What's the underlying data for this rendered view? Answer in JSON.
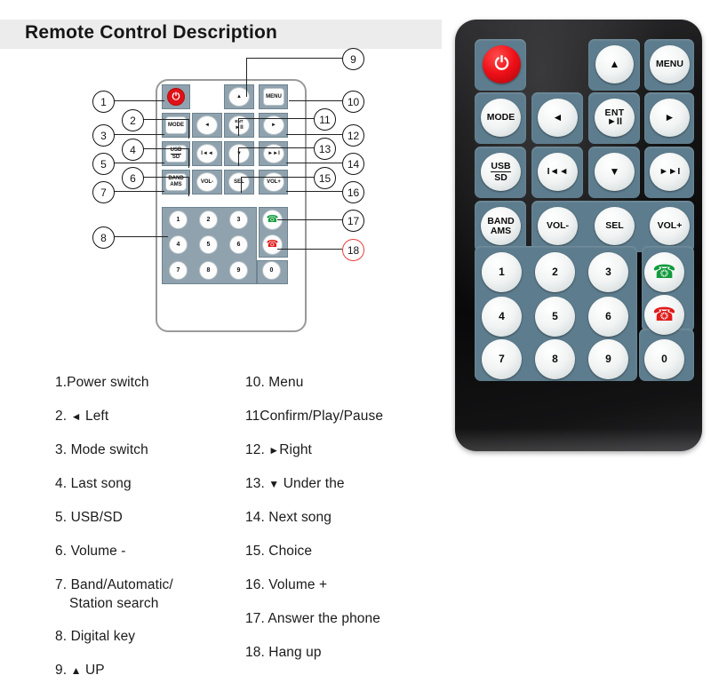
{
  "header": {
    "title": "Remote Control Description"
  },
  "diagram": {
    "name": "remote-control-line-drawing",
    "buttons": [
      {
        "key": "power",
        "label": "",
        "type": "power"
      },
      {
        "key": "up",
        "label": "▲",
        "type": "round"
      },
      {
        "key": "menu",
        "label": "MENU",
        "type": "square"
      },
      {
        "key": "mode",
        "label": "MODE",
        "type": "square"
      },
      {
        "key": "left",
        "label": "◄",
        "type": "round"
      },
      {
        "key": "ent",
        "label": "ENT",
        "label2": "►II",
        "type": "round"
      },
      {
        "key": "right",
        "label": "►",
        "type": "round"
      },
      {
        "key": "usbsd",
        "label": "USB",
        "label2": "SD",
        "type": "square"
      },
      {
        "key": "prev",
        "label": "I◄◄",
        "type": "round"
      },
      {
        "key": "down",
        "label": "▼",
        "type": "round"
      },
      {
        "key": "next",
        "label": "►►I",
        "type": "round"
      },
      {
        "key": "bandams",
        "label": "BAND",
        "label2": "AMS",
        "type": "square"
      },
      {
        "key": "volminus",
        "label": "VOL-",
        "type": "round"
      },
      {
        "key": "sel",
        "label": "SEL",
        "type": "round"
      },
      {
        "key": "volplus",
        "label": "VOL+",
        "type": "round"
      }
    ],
    "keypad": [
      "1",
      "2",
      "3",
      "4",
      "5",
      "6",
      "7",
      "8",
      "9",
      "0"
    ],
    "call_buttons": [
      {
        "key": "answer",
        "glyph": "✆",
        "color": "#0f9d3a"
      },
      {
        "key": "hangup",
        "glyph": "✆",
        "color": "#e11b1b"
      }
    ],
    "callouts": [
      {
        "n": "1"
      },
      {
        "n": "2"
      },
      {
        "n": "3"
      },
      {
        "n": "4"
      },
      {
        "n": "5"
      },
      {
        "n": "6"
      },
      {
        "n": "7"
      },
      {
        "n": "8"
      },
      {
        "n": "9"
      },
      {
        "n": "10"
      },
      {
        "n": "11"
      },
      {
        "n": "12"
      },
      {
        "n": "13"
      },
      {
        "n": "14"
      },
      {
        "n": "15"
      },
      {
        "n": "16"
      },
      {
        "n": "17"
      },
      {
        "n": "18"
      }
    ]
  },
  "photo": {
    "name": "remote-control-photo",
    "buttons": [
      {
        "key": "power",
        "label": "",
        "label2": ""
      },
      {
        "key": "up",
        "label": "▲",
        "label2": ""
      },
      {
        "key": "menu",
        "label": "MENU",
        "label2": ""
      },
      {
        "key": "mode",
        "label": "MODE",
        "label2": ""
      },
      {
        "key": "left",
        "label": "◄",
        "label2": ""
      },
      {
        "key": "ent",
        "label": "ENT",
        "label2": "►II"
      },
      {
        "key": "right",
        "label": "►",
        "label2": ""
      },
      {
        "key": "usbsd",
        "label": "USB",
        "label2": "SD"
      },
      {
        "key": "prev",
        "label": "I◄◄",
        "label2": ""
      },
      {
        "key": "down",
        "label": "▼",
        "label2": ""
      },
      {
        "key": "next",
        "label": "►►I",
        "label2": ""
      },
      {
        "key": "bandams",
        "label": "BAND",
        "label2": "AMS"
      },
      {
        "key": "volminus",
        "label": "VOL-",
        "label2": ""
      },
      {
        "key": "sel",
        "label": "SEL",
        "label2": ""
      },
      {
        "key": "volplus",
        "label": "VOL+",
        "label2": ""
      }
    ],
    "keypad": [
      "1",
      "2",
      "3",
      "4",
      "5",
      "6",
      "7",
      "8",
      "9",
      "0"
    ],
    "call_buttons": [
      {
        "key": "answer",
        "glyph": "✆"
      },
      {
        "key": "hangup",
        "glyph": "✆"
      }
    ]
  },
  "legend": {
    "left": [
      {
        "num": "1.",
        "glyph": "",
        "text": "Power switch",
        "sub": ""
      },
      {
        "num": "2.",
        "glyph": "◄",
        "text": "Left",
        "sub": ""
      },
      {
        "num": "3.",
        "glyph": "",
        "text": "Mode switch",
        "sub": ""
      },
      {
        "num": "4.",
        "glyph": "",
        "text": "Last song",
        "sub": ""
      },
      {
        "num": "5.",
        "glyph": "",
        "text": "USB/SD",
        "sub": ""
      },
      {
        "num": "6.",
        "glyph": "",
        "text": "Volume -",
        "sub": ""
      },
      {
        "num": "7.",
        "glyph": "",
        "text": "Band/Automatic/",
        "sub": "Station search"
      },
      {
        "num": "8.",
        "glyph": "",
        "text": "Digital key",
        "sub": ""
      },
      {
        "num": "9.",
        "glyph": "▲",
        "text": "UP",
        "sub": ""
      }
    ],
    "right": [
      {
        "num": "10.",
        "glyph": "",
        "text": "Menu",
        "sub": ""
      },
      {
        "num": "11",
        "glyph": "",
        "text": "Confirm/Play/Pause",
        "sub": ""
      },
      {
        "num": "12.",
        "glyph": "►",
        "text": "Right",
        "sub": ""
      },
      {
        "num": "13.",
        "glyph": "▼",
        "text": "Under the",
        "sub": ""
      },
      {
        "num": "14.",
        "glyph": "",
        "text": "Next song",
        "sub": ""
      },
      {
        "num": "15.",
        "glyph": "",
        "text": "Choice",
        "sub": ""
      },
      {
        "num": "16.",
        "glyph": "",
        "text": "Volume +",
        "sub": ""
      },
      {
        "num": "17.",
        "glyph": "",
        "text": "Answer the phone",
        "sub": ""
      },
      {
        "num": "18.",
        "glyph": "",
        "text": "Hang up",
        "sub": ""
      }
    ]
  },
  "colors": {
    "title_band": "#ececed",
    "pad_photo": "#5d7d8e",
    "pad_diagram": "#8fa2ad",
    "power_red": "#e10f16",
    "answer_green": "#0f9d3a",
    "hangup_red": "#e11b1b",
    "callout_red": "#ee3d3d"
  }
}
